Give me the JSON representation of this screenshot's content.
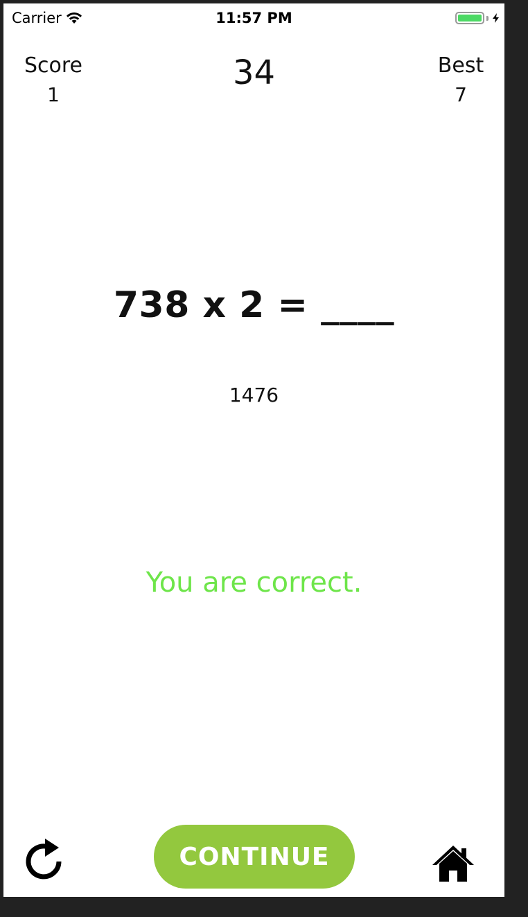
{
  "status_bar": {
    "carrier": "Carrier",
    "time": "11:57 PM",
    "battery_color": "#4cd964"
  },
  "scoreboard": {
    "score_label": "Score",
    "score_value": "1",
    "timer": "34",
    "best_label": "Best",
    "best_value": "7"
  },
  "problem": {
    "question": "738 x 2 = ____",
    "answer": "1476"
  },
  "feedback": {
    "message": "You are correct.",
    "color": "#6ee54a"
  },
  "controls": {
    "restart_icon": "restart-icon",
    "continue_label": "CONTINUE",
    "continue_color": "#93c83e",
    "home_icon": "home-icon"
  }
}
